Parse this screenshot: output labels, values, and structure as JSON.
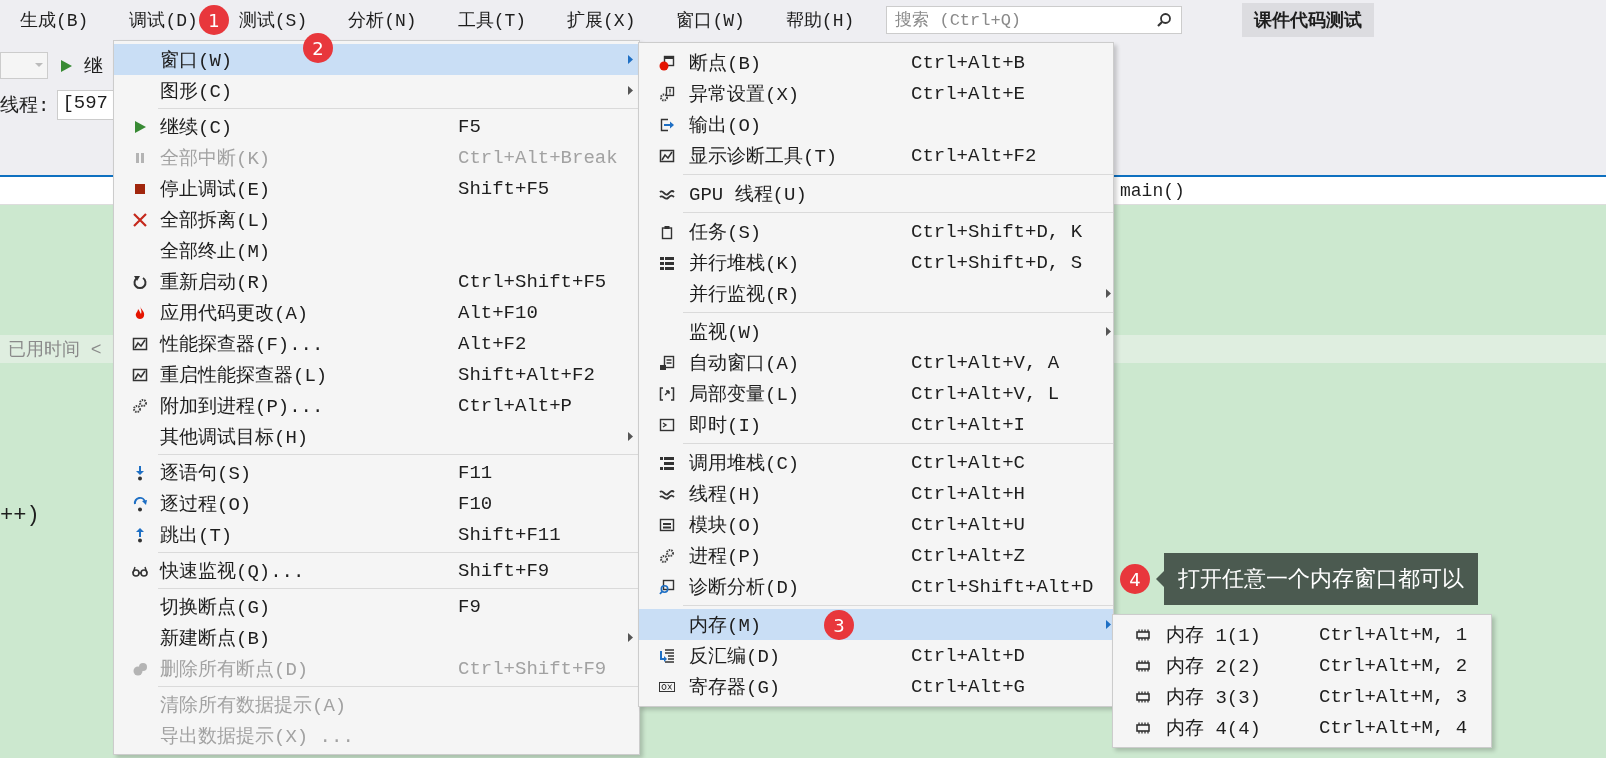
{
  "menubar": {
    "items": [
      {
        "label": "生成(B)"
      },
      {
        "label": "调试(D)"
      },
      {
        "label": "测试(S)"
      },
      {
        "label": "分析(N)"
      },
      {
        "label": "工具(T)"
      },
      {
        "label": "扩展(X)"
      },
      {
        "label": "窗口(W)"
      },
      {
        "label": "帮助(H)"
      }
    ],
    "search": {
      "placeholder": "搜索 (Ctrl+Q)"
    },
    "button": "课件代码测试"
  },
  "toolbar": {
    "continue_label": "继",
    "thread_label": "线程:",
    "thread_value": "[597"
  },
  "navigation_bar": {
    "function": "main()"
  },
  "editor": {
    "elapsed_label": "已用时间 <",
    "code_line": "++)"
  },
  "debug_menu": {
    "groups": [
      [
        {
          "label": "窗口(W)",
          "selected": true,
          "disabled": false,
          "submenu": true
        },
        {
          "label": "图形(C)",
          "selected": false,
          "disabled": false,
          "submenu": true
        }
      ],
      [
        {
          "label": "继续(C)",
          "shortcut": "F5",
          "selected": false,
          "disabled": false,
          "submenu": false
        },
        {
          "label": "全部中断(K)",
          "shortcut": "Ctrl+Alt+Break",
          "selected": false,
          "disabled": true,
          "submenu": false
        },
        {
          "label": "停止调试(E)",
          "shortcut": "Shift+F5",
          "selected": false,
          "disabled": false,
          "submenu": false
        },
        {
          "label": "全部拆离(L)",
          "selected": false,
          "disabled": false,
          "submenu": false
        },
        {
          "label": "全部终止(M)",
          "selected": false,
          "disabled": false,
          "submenu": false
        },
        {
          "label": "重新启动(R)",
          "shortcut": "Ctrl+Shift+F5",
          "selected": false,
          "disabled": false,
          "submenu": false
        },
        {
          "label": "应用代码更改(A)",
          "shortcut": "Alt+F10",
          "selected": false,
          "disabled": false,
          "submenu": false
        },
        {
          "label": "性能探查器(F)...",
          "shortcut": "Alt+F2",
          "selected": false,
          "disabled": false,
          "submenu": false
        },
        {
          "label": "重启性能探查器(L)",
          "shortcut": "Shift+Alt+F2",
          "selected": false,
          "disabled": false,
          "submenu": false
        },
        {
          "label": "附加到进程(P)...",
          "shortcut": "Ctrl+Alt+P",
          "selected": false,
          "disabled": false,
          "submenu": false
        },
        {
          "label": "其他调试目标(H)",
          "selected": false,
          "disabled": false,
          "submenu": true
        }
      ],
      [
        {
          "label": "逐语句(S)",
          "shortcut": "F11",
          "selected": false,
          "disabled": false,
          "submenu": false
        },
        {
          "label": "逐过程(O)",
          "shortcut": "F10",
          "selected": false,
          "disabled": false,
          "submenu": false
        },
        {
          "label": "跳出(T)",
          "shortcut": "Shift+F11",
          "selected": false,
          "disabled": false,
          "submenu": false
        }
      ],
      [
        {
          "label": "快速监视(Q)...",
          "shortcut": "Shift+F9",
          "selected": false,
          "disabled": false,
          "submenu": false
        }
      ],
      [
        {
          "label": "切换断点(G)",
          "shortcut": "F9",
          "selected": false,
          "disabled": false,
          "submenu": false
        },
        {
          "label": "新建断点(B)",
          "selected": false,
          "disabled": false,
          "submenu": true
        },
        {
          "label": "删除所有断点(D)",
          "shortcut": "Ctrl+Shift+F9",
          "selected": false,
          "disabled": true,
          "submenu": false
        }
      ],
      [
        {
          "label": "清除所有数据提示(A)",
          "selected": false,
          "disabled": true,
          "submenu": false
        },
        {
          "label": "导出数据提示(X) ...",
          "selected": false,
          "disabled": true,
          "submenu": false
        }
      ]
    ]
  },
  "window_menu": {
    "groups": [
      [
        {
          "label": "断点(B)",
          "shortcut": "Ctrl+Alt+B",
          "selected": false,
          "disabled": false,
          "submenu": false
        },
        {
          "label": "异常设置(X)",
          "shortcut": "Ctrl+Alt+E",
          "selected": false,
          "disabled": false,
          "submenu": false
        },
        {
          "label": "输出(O)",
          "selected": false,
          "disabled": false,
          "submenu": false
        },
        {
          "label": "显示诊断工具(T)",
          "shortcut": "Ctrl+Alt+F2",
          "selected": false,
          "disabled": false,
          "submenu": false
        }
      ],
      [
        {
          "label": "GPU 线程(U)",
          "selected": false,
          "disabled": false,
          "submenu": false
        }
      ],
      [
        {
          "label": "任务(S)",
          "shortcut": "Ctrl+Shift+D, K",
          "selected": false,
          "disabled": false,
          "submenu": false
        },
        {
          "label": "并行堆栈(K)",
          "shortcut": "Ctrl+Shift+D, S",
          "selected": false,
          "disabled": false,
          "submenu": false
        },
        {
          "label": "并行监视(R)",
          "selected": false,
          "disabled": false,
          "submenu": true
        }
      ],
      [
        {
          "label": "监视(W)",
          "selected": false,
          "disabled": false,
          "submenu": true
        },
        {
          "label": "自动窗口(A)",
          "shortcut": "Ctrl+Alt+V, A",
          "selected": false,
          "disabled": false,
          "submenu": false
        },
        {
          "label": "局部变量(L)",
          "shortcut": "Ctrl+Alt+V, L",
          "selected": false,
          "disabled": false,
          "submenu": false
        },
        {
          "label": "即时(I)",
          "shortcut": "Ctrl+Alt+I",
          "selected": false,
          "disabled": false,
          "submenu": false
        }
      ],
      [
        {
          "label": "调用堆栈(C)",
          "shortcut": "Ctrl+Alt+C",
          "selected": false,
          "disabled": false,
          "submenu": false
        },
        {
          "label": "线程(H)",
          "shortcut": "Ctrl+Alt+H",
          "selected": false,
          "disabled": false,
          "submenu": false
        },
        {
          "label": "模块(O)",
          "shortcut": "Ctrl+Alt+U",
          "selected": false,
          "disabled": false,
          "submenu": false
        },
        {
          "label": "进程(P)",
          "shortcut": "Ctrl+Alt+Z",
          "selected": false,
          "disabled": false,
          "submenu": false
        },
        {
          "label": "诊断分析(D)",
          "shortcut": "Ctrl+Shift+Alt+D",
          "selected": false,
          "disabled": false,
          "submenu": false
        }
      ],
      [
        {
          "label": "内存(M)",
          "selected": true,
          "disabled": false,
          "submenu": true
        },
        {
          "label": "反汇编(D)",
          "shortcut": "Ctrl+Alt+D",
          "selected": false,
          "disabled": false,
          "submenu": false
        },
        {
          "label": "寄存器(G)",
          "shortcut": "Ctrl+Alt+G",
          "selected": false,
          "disabled": false,
          "submenu": false
        }
      ]
    ]
  },
  "memory_menu": {
    "groups": [
      [
        {
          "label": "内存 1(1)",
          "shortcut": "Ctrl+Alt+M, 1",
          "selected": false,
          "disabled": false,
          "submenu": false
        },
        {
          "label": "内存 2(2)",
          "shortcut": "Ctrl+Alt+M, 2",
          "selected": false,
          "disabled": false,
          "submenu": false
        },
        {
          "label": "内存 3(3)",
          "shortcut": "Ctrl+Alt+M, 3",
          "selected": false,
          "disabled": false,
          "submenu": false
        },
        {
          "label": "内存 4(4)",
          "shortcut": "Ctrl+Alt+M, 4",
          "selected": false,
          "disabled": false,
          "submenu": false
        }
      ]
    ]
  },
  "step_badges": [
    {
      "label": "1"
    },
    {
      "label": "2"
    },
    {
      "label": "3"
    }
  ],
  "callout": {
    "badge": "4",
    "text": "打开任意一个内存窗口都可以"
  }
}
